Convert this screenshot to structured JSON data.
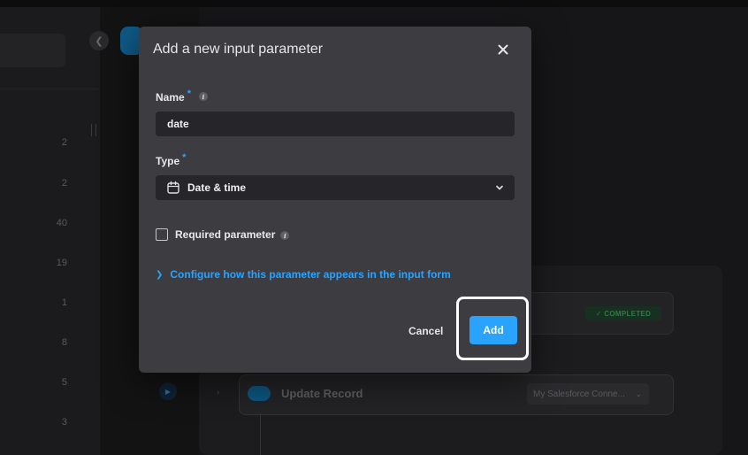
{
  "background": {
    "row_counts": [
      "2",
      "2",
      "40",
      "19",
      "1",
      "8",
      "5",
      "3"
    ],
    "completed_badge": "✓ COMPLETED",
    "update_record_title": "Update Record",
    "connection_select": "My Salesforce Conne..."
  },
  "modal": {
    "title": "Add a new input parameter",
    "name_label": "Name",
    "name_value": "date",
    "type_label": "Type",
    "type_value": "Date & time",
    "required_label": "Required parameter",
    "configure_link": "Configure how this parameter appears in the input form",
    "cancel_label": "Cancel",
    "add_label": "Add",
    "required_marker": "*",
    "info_glyph": "i",
    "accent_color": "#2aa3ff"
  }
}
